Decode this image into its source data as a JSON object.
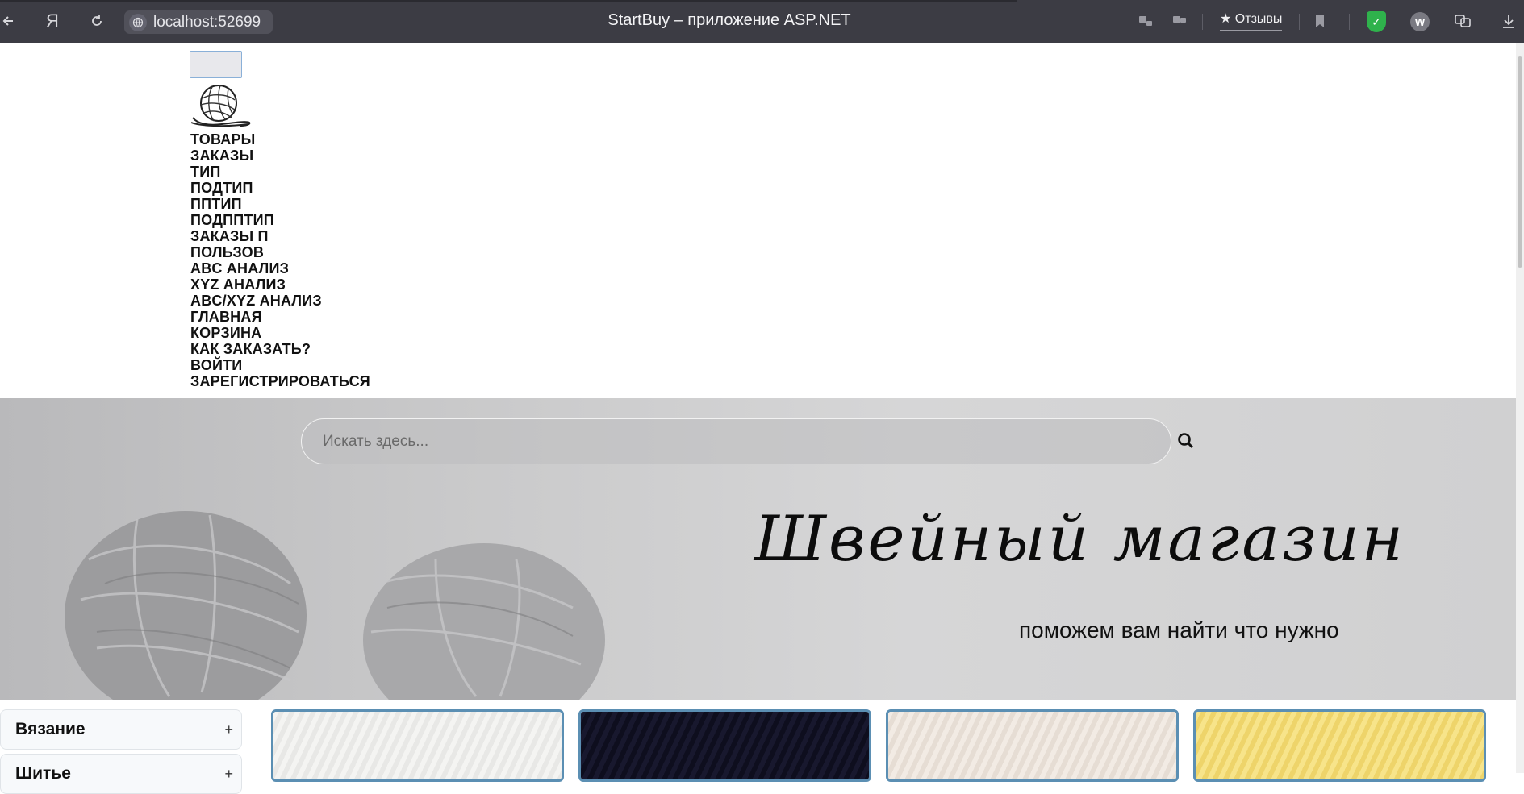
{
  "browser": {
    "url": "localhost:52699",
    "page_title": "StartBuy – приложение ASP.NET",
    "reviews_label": "★ Отзывы",
    "profile_initial": "W",
    "back_icon": "back-arrow-icon",
    "yandex_icon": "yandex-logo-icon",
    "reload_icon": "reload-icon"
  },
  "nav": {
    "logo_icon": "yarn-ball-icon",
    "items": [
      {
        "label": "ТОВАРЫ"
      },
      {
        "label": "ЗАКАЗЫ"
      },
      {
        "label": "ТИП"
      },
      {
        "label": "ПОДТИП"
      },
      {
        "label": "ППТИП"
      },
      {
        "label": "ПОДППТИП"
      },
      {
        "label": "ЗАКАЗЫ П"
      },
      {
        "label": "ПОЛЬЗОВ"
      },
      {
        "label": "ABC АНАЛИЗ"
      },
      {
        "label": "XYZ АНАЛИЗ"
      },
      {
        "label": "ABC/XYZ АНАЛИЗ"
      },
      {
        "label": "ГЛАВНАЯ"
      },
      {
        "label": "КОРЗИНА"
      },
      {
        "label": "КАК ЗАКАЗАТЬ?"
      },
      {
        "label": "ВОЙТИ"
      },
      {
        "label": "ЗАРЕГИСТРИРОВАТЬСЯ"
      }
    ]
  },
  "hero": {
    "search_placeholder": "Искать здесь...",
    "title": "Швейный магазин",
    "subtitle": "поможем вам найти что нужно"
  },
  "categories": [
    {
      "label": "Вязание",
      "toggle": "+"
    },
    {
      "label": "Шитье",
      "toggle": "+"
    }
  ],
  "products": [
    {
      "color": "#f0f0ee"
    },
    {
      "color": "#14142a"
    },
    {
      "color": "#efe7df"
    },
    {
      "color": "#f4e07e"
    }
  ]
}
